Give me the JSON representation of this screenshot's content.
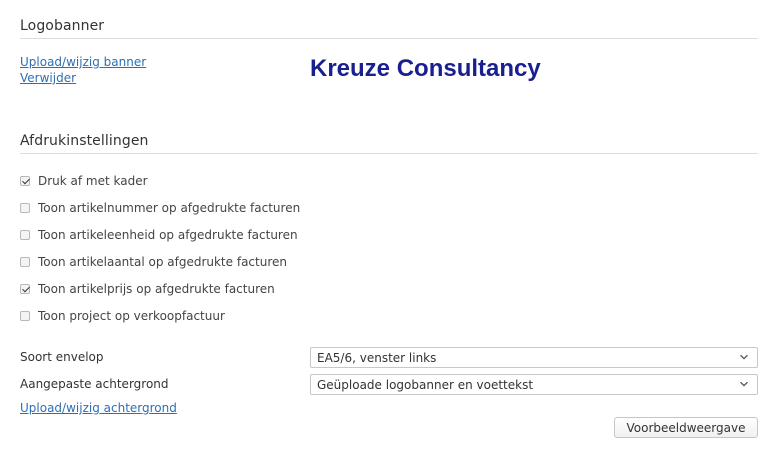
{
  "logobanner": {
    "title": "Logobanner",
    "upload_link": "Upload/wijzig banner",
    "remove_link": "Verwijder",
    "brand_text": "Kreuze Consultancy",
    "brand_color": "#1a1f8f"
  },
  "print_settings": {
    "title": "Afdrukinstellingen",
    "options": [
      {
        "label": "Druk af met kader",
        "checked": true
      },
      {
        "label": "Toon artikelnummer op afgedrukte facturen",
        "checked": false
      },
      {
        "label": "Toon artikeleenheid op afgedrukte facturen",
        "checked": false
      },
      {
        "label": "Toon artikelaantal op afgedrukte facturen",
        "checked": false
      },
      {
        "label": "Toon artikelprijs op afgedrukte facturen",
        "checked": true
      },
      {
        "label": "Toon project op verkoopfactuur",
        "checked": false
      }
    ]
  },
  "envelope": {
    "label": "Soort envelop",
    "value": "EA5/6, venster links"
  },
  "background": {
    "label": "Aangepaste achtergrond",
    "value": "Geüploade logobanner en voettekst",
    "upload_link": "Upload/wijzig achtergrond"
  },
  "preview_button": "Voorbeeldweergave",
  "colors": {
    "link": "#2c6fb5",
    "divider": "#dcdcdc"
  }
}
